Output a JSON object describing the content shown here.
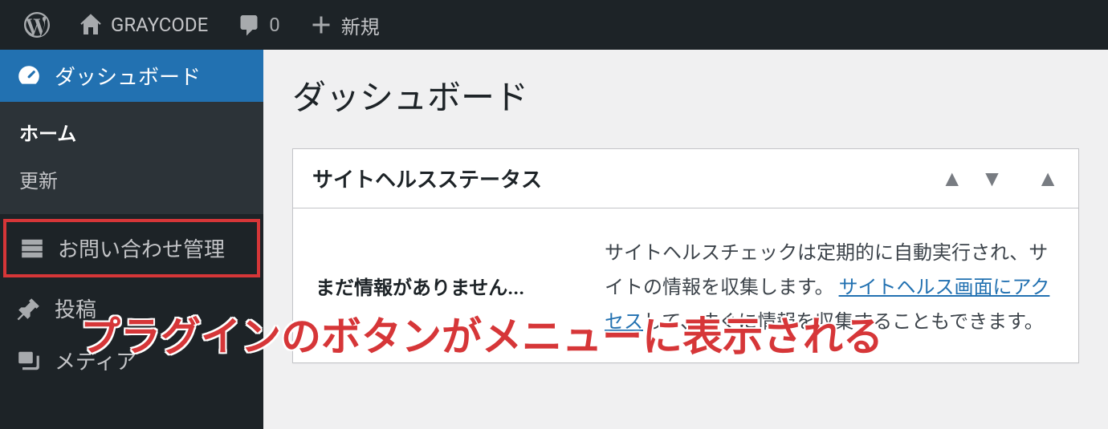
{
  "adminbar": {
    "site_name": "GRAYCODE",
    "comment_count": "0",
    "new_label": "新規"
  },
  "sidebar": {
    "dashboard": "ダッシュボード",
    "submenu": {
      "home": "ホーム",
      "updates": "更新"
    },
    "contact_admin": "お問い合わせ管理",
    "posts": "投稿",
    "media": "メディア"
  },
  "main": {
    "heading": "ダッシュボード",
    "site_health": {
      "title": "サイトヘルスステータス",
      "no_info_label": "まだ情報がありません...",
      "body_text_1": "サイトヘルスチェックは定期的に自動実行され、サイトの情報を収集します。",
      "link_text": "サイトヘルス画面にアクセス",
      "body_text_2": "して、すぐに情報を収集することもできます。"
    }
  },
  "annotation": "プラグインのボタンがメニューに表示される"
}
